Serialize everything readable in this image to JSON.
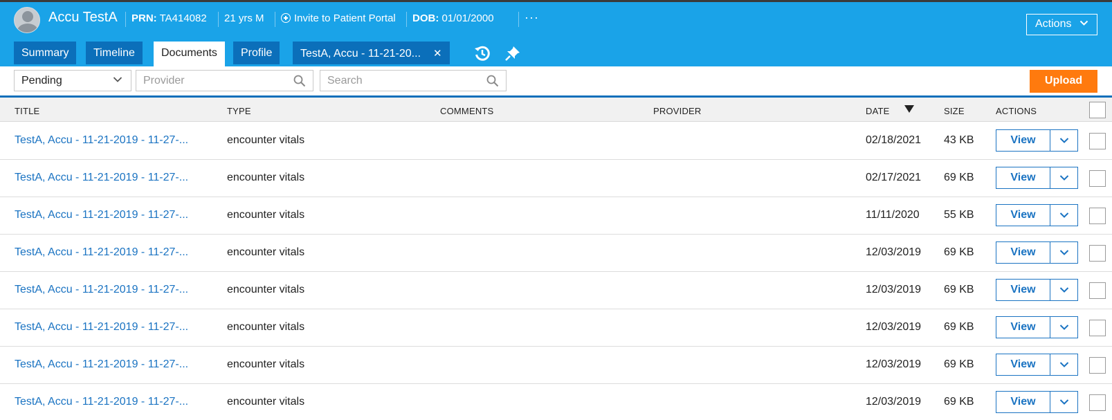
{
  "patient": {
    "name": "Accu TestA",
    "prn_label": "PRN:",
    "prn_value": "TA414082",
    "age_sex": "21 yrs M",
    "portal_link": "Invite to Patient Portal",
    "dob_label": "DOB:",
    "dob_value": "01/01/2000",
    "more": "···"
  },
  "header": {
    "actions_label": "Actions"
  },
  "tabs": [
    {
      "label": "Summary"
    },
    {
      "label": "Timeline"
    },
    {
      "label": "Documents",
      "active": true
    },
    {
      "label": "Profile"
    },
    {
      "label": "TestA, Accu - 11-21-20...",
      "closable": true
    }
  ],
  "filters": {
    "status_selected": "Pending",
    "provider_placeholder": "Provider",
    "search_placeholder": "Search",
    "upload_label": "Upload"
  },
  "table": {
    "columns": {
      "title": "TITLE",
      "type": "TYPE",
      "comments": "COMMENTS",
      "provider": "PROVIDER",
      "date": "DATE",
      "size": "SIZE",
      "actions": "ACTIONS"
    },
    "view_label": "View",
    "rows": [
      {
        "title": "TestA, Accu - 11-21-2019 - 11-27-...",
        "type": "encounter vitals",
        "comments": "",
        "provider": "",
        "date": "02/18/2021",
        "size": "43 KB"
      },
      {
        "title": "TestA, Accu - 11-21-2019 - 11-27-...",
        "type": "encounter vitals",
        "comments": "",
        "provider": "",
        "date": "02/17/2021",
        "size": "69 KB"
      },
      {
        "title": "TestA, Accu - 11-21-2019 - 11-27-...",
        "type": "encounter vitals",
        "comments": "",
        "provider": "",
        "date": "11/11/2020",
        "size": "55 KB"
      },
      {
        "title": "TestA, Accu - 11-21-2019 - 11-27-...",
        "type": "encounter vitals",
        "comments": "",
        "provider": "",
        "date": "12/03/2019",
        "size": "69 KB"
      },
      {
        "title": "TestA, Accu - 11-21-2019 - 11-27-...",
        "type": "encounter vitals",
        "comments": "",
        "provider": "",
        "date": "12/03/2019",
        "size": "69 KB"
      },
      {
        "title": "TestA, Accu - 11-21-2019 - 11-27-...",
        "type": "encounter vitals",
        "comments": "",
        "provider": "",
        "date": "12/03/2019",
        "size": "69 KB"
      },
      {
        "title": "TestA, Accu - 11-21-2019 - 11-27-...",
        "type": "encounter vitals",
        "comments": "",
        "provider": "",
        "date": "12/03/2019",
        "size": "69 KB"
      },
      {
        "title": "TestA, Accu - 11-21-2019 - 11-27-...",
        "type": "encounter vitals",
        "comments": "",
        "provider": "",
        "date": "12/03/2019",
        "size": "69 KB"
      }
    ]
  },
  "colors": {
    "header_bg": "#1aa3e8",
    "tab_bg": "#0b6fba",
    "link": "#1a73c2",
    "upload": "#ff7a0e"
  },
  "icons": {
    "avatar": "user-avatar-icon",
    "portal": "plus-circle-icon",
    "history": "history-icon",
    "pin": "pin-icon",
    "search": "search-icon",
    "chevron": "chevron-down-icon",
    "close": "close-icon",
    "sort": "sort-desc-icon"
  }
}
